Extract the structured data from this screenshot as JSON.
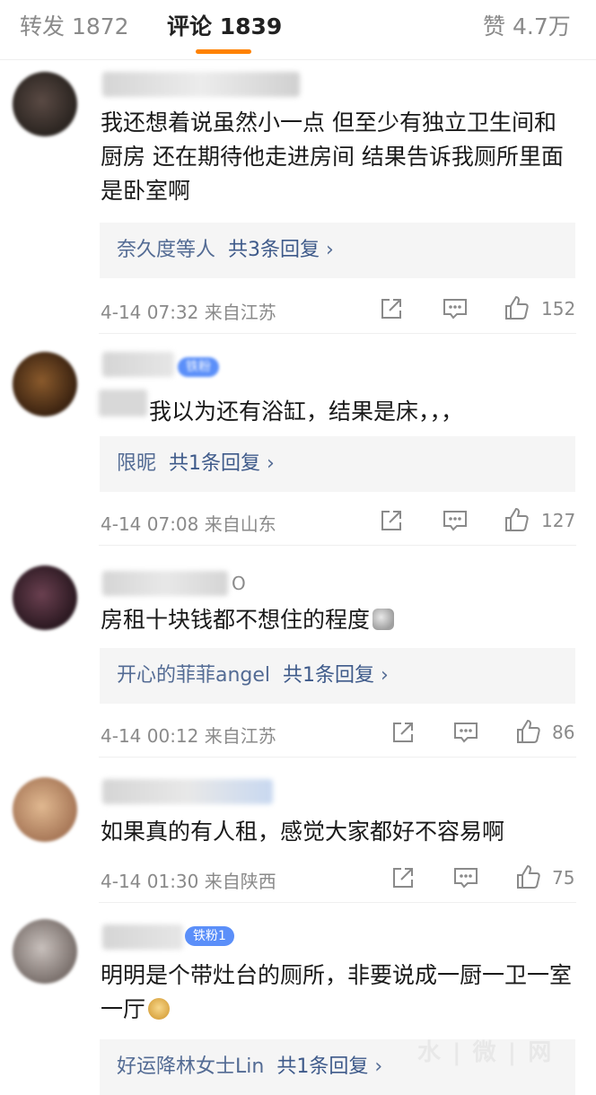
{
  "tabs": {
    "repost": {
      "label": "转发",
      "count": "1872"
    },
    "comments": {
      "label": "评论",
      "count": "1839"
    },
    "likes": {
      "label": "赞",
      "count": "4.7万"
    }
  },
  "comments": [
    {
      "text": "我还想着说虽然小一点 但至少有独立卫生间和厨房 还在期待他走进房间 结果告诉我厕所里面是卧室啊",
      "reply_from": "奈久度等人",
      "reply_count": "共3条回复",
      "time": "4-14 07:32",
      "location": "来自江苏",
      "likes": "152"
    },
    {
      "badge": "铁粉",
      "text": "我以为还有浴缸，结果是床，，，",
      "reply_from": "限昵",
      "reply_count": "共1条回复",
      "time": "4-14 07:08",
      "location": "来自山东",
      "likes": "127"
    },
    {
      "name_tail": "O",
      "text": "房租十块钱都不想住的程度",
      "reply_from": "开心的菲菲angel",
      "reply_count": "共1条回复",
      "time": "4-14 00:12",
      "location": "来自江苏",
      "likes": "86"
    },
    {
      "text": "如果真的有人租，感觉大家都好不容易啊",
      "time": "4-14 01:30",
      "location": "来自陕西",
      "likes": "75"
    },
    {
      "badge": "铁粉1",
      "text": "明明是个带灶台的厕所，非要说成一厨一卫一室一厅",
      "reply_from": "好运降林女士Lin",
      "reply_count": "共1条回复"
    }
  ],
  "icons": {
    "reply_chevron": "chevron-right-icon",
    "share": "share-icon",
    "comment": "comment-icon",
    "like": "thumbs-up-icon"
  },
  "colors": {
    "accent": "#ff8200",
    "reply_link": "#536b94",
    "badge": "#5b8ff9",
    "meta": "#8a8a8a"
  }
}
